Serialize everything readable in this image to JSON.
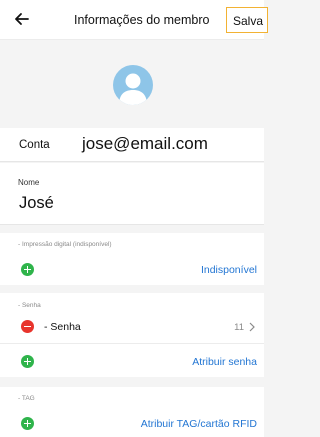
{
  "header": {
    "title": "Informações do membro",
    "save_label": "Salva"
  },
  "account": {
    "label": "Conta",
    "value": "jose@email.com"
  },
  "name": {
    "label": "Nome",
    "value": "José"
  },
  "fingerprint": {
    "section_label": "- Impressão digital (indisponível)",
    "action_label": "Indisponível"
  },
  "password": {
    "section_label": "- Senha",
    "item_label": "- Senha",
    "item_count": "11",
    "action_label": "Atribuir senha"
  },
  "tag": {
    "section_label": "- TAG",
    "action_label": "Atribuir TAG/cartão RFID"
  },
  "colors": {
    "accent_border": "#f2b233",
    "link": "#2376d3",
    "add": "#2fb44b",
    "remove": "#e8342c",
    "avatar": "#8ec5e8"
  },
  "icons": {
    "back": "arrow-left-icon",
    "avatar": "user-avatar-icon",
    "add": "plus-circle-icon",
    "remove": "minus-circle-icon",
    "chevron": "chevron-right-icon"
  }
}
